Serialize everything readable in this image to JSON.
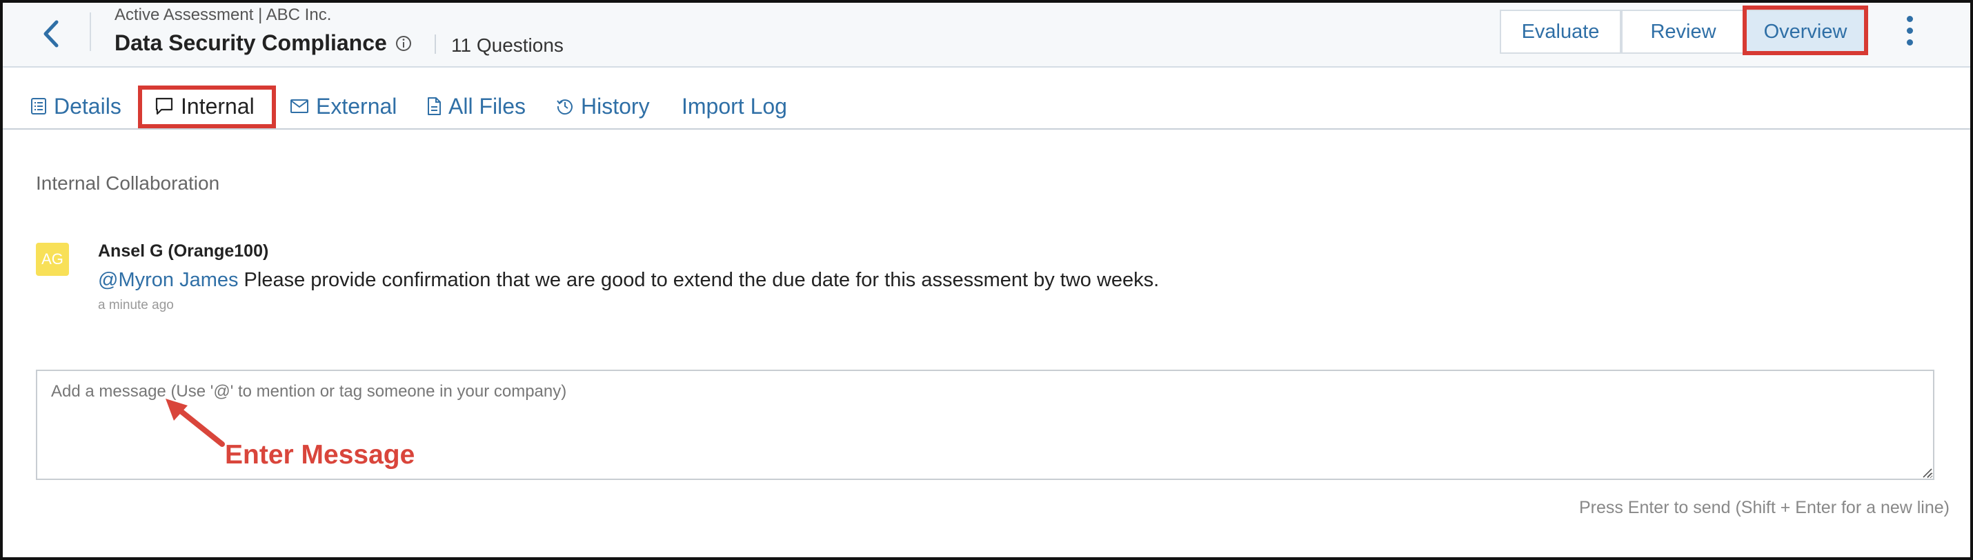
{
  "header": {
    "breadcrumb": "Active Assessment | ABC Inc.",
    "title": "Data Security Compliance",
    "question_count": "11 Questions",
    "buttons": {
      "evaluate": "Evaluate",
      "review": "Review",
      "overview": "Overview"
    }
  },
  "tabs": [
    {
      "label": "Details",
      "icon": "list-icon"
    },
    {
      "label": "Internal",
      "icon": "chat-icon"
    },
    {
      "label": "External",
      "icon": "mail-icon"
    },
    {
      "label": "All Files",
      "icon": "file-icon"
    },
    {
      "label": "History",
      "icon": "history-icon"
    },
    {
      "label": "Import Log",
      "icon": ""
    }
  ],
  "section": {
    "title": "Internal Collaboration"
  },
  "comment": {
    "avatar_initials": "AG",
    "author": "Ansel G (Orange100)",
    "mention": "@Myron James",
    "text": " Please provide confirmation that we are good to extend the due date for this assessment by two weeks.",
    "time": "a minute ago"
  },
  "composer": {
    "placeholder": "Add a message (Use '@' to mention or tag someone in your company)",
    "hint": "Press Enter to send (Shift + Enter for a new line)"
  },
  "annotation": {
    "label": "Enter Message"
  },
  "colors": {
    "accent": "#2f6fa6",
    "highlight": "#d73a33",
    "avatar": "#f8e058"
  }
}
